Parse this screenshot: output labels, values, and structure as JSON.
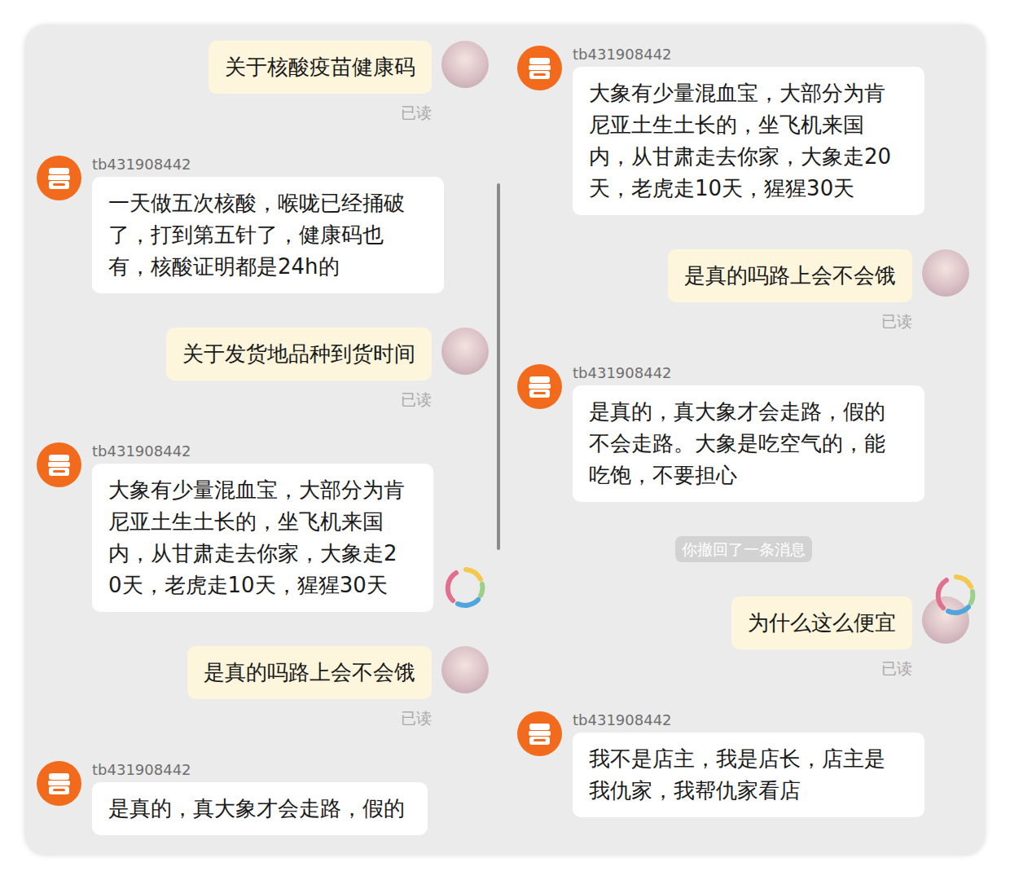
{
  "panels": [
    {
      "messages": [
        {
          "kind": "sent",
          "text": "关于核酸疫苗健康码",
          "read": "已读",
          "loading": false
        },
        {
          "kind": "received",
          "sender": "tb431908442",
          "text": "一天做五次核酸，喉咙已经捅破了，打到第五针了，健康码也有，核酸证明都是24h的",
          "loading": false
        },
        {
          "kind": "sent",
          "text": "关于发货地品种到货时间",
          "read": "已读",
          "loading": false
        },
        {
          "kind": "received",
          "sender": "tb431908442",
          "text": "大象有少量混血宝，大部分为肯尼亚土生土长的，坐飞机来国内，从甘肃走去你家，大象走20天，老虎走10天，猩猩30天",
          "loading": true
        },
        {
          "kind": "sent",
          "text": "是真的吗路上会不会饿",
          "read": "已读",
          "loading": false
        },
        {
          "kind": "received",
          "sender": "tb431908442",
          "text": "是真的，真大象才会走路，假的",
          "loading": false
        }
      ]
    },
    {
      "messages": [
        {
          "kind": "received",
          "sender": "tb431908442",
          "text": "大象有少量混血宝，大部分为肯尼亚土生土长的，坐飞机来国内，从甘肃走去你家，大象走20天，老虎走10天，猩猩30天",
          "loading": false
        },
        {
          "kind": "sent",
          "text": "是真的吗路上会不会饿",
          "read": "已读",
          "loading": false
        },
        {
          "kind": "received",
          "sender": "tb431908442",
          "text": "是真的，真大象才会走路，假的不会走路。大象是吃空气的，能吃饱，不要担心",
          "loading": false
        },
        {
          "kind": "system",
          "text": "你撤回了一条消息",
          "loading": false
        },
        {
          "kind": "sent",
          "text": "为什么这么便宜",
          "read": "已读",
          "loading": true
        },
        {
          "kind": "received",
          "sender": "tb431908442",
          "text": "我不是店主，我是店长，店主是我仇家，我帮仇家看店",
          "loading": false
        }
      ]
    }
  ]
}
